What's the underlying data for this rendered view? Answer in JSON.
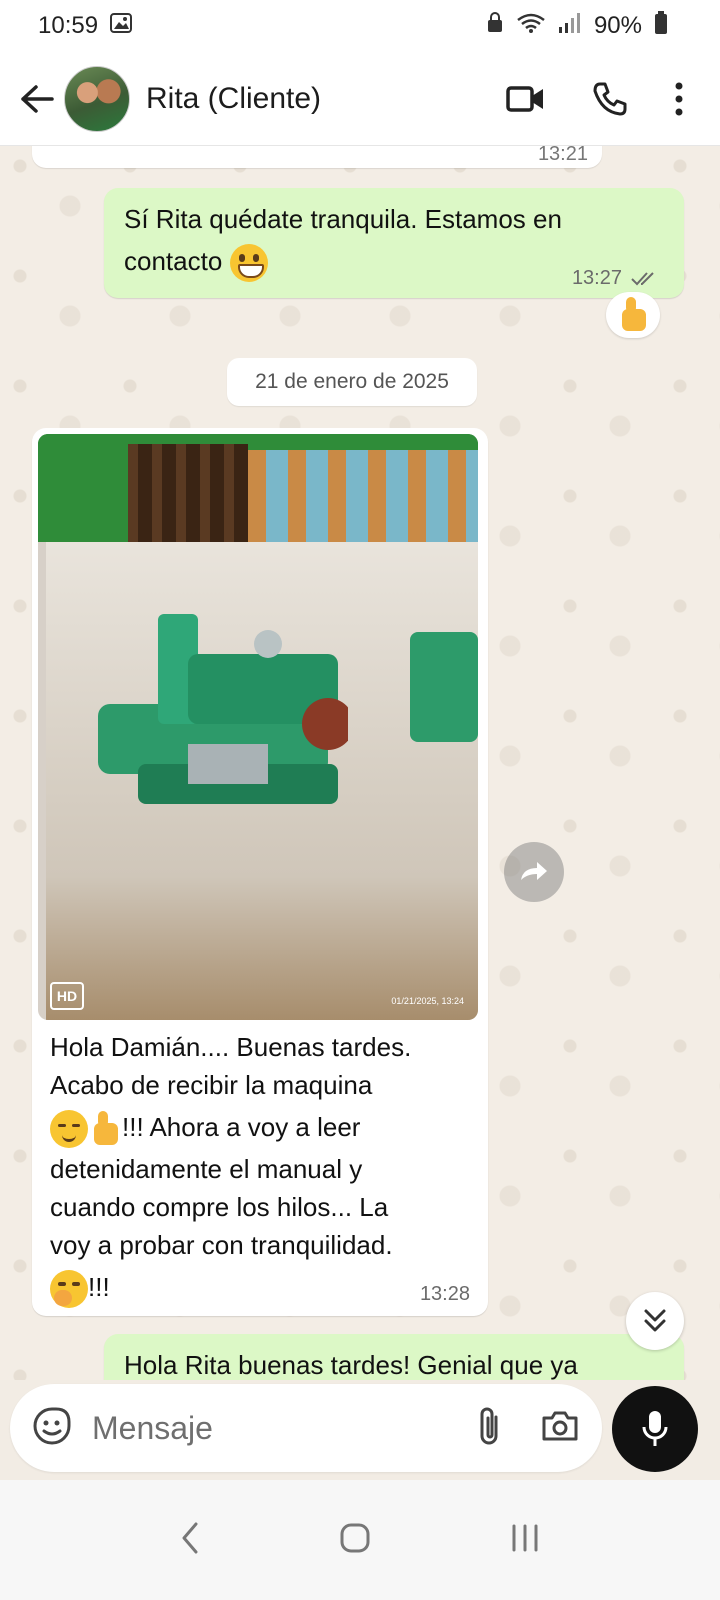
{
  "status_bar": {
    "time": "10:59",
    "battery": "90%"
  },
  "header": {
    "contact_name": "Rita (Cliente)",
    "icons": [
      "back-arrow-icon",
      "video-call-icon",
      "phone-icon",
      "more-vert-icon"
    ]
  },
  "chat": {
    "previous_time": "13:21",
    "messages": [
      {
        "direction": "out",
        "lines": [
          "Sí Rita quédate tranquila. Estamos en",
          "contacto"
        ],
        "emoji": "grinning-face",
        "time": "13:27",
        "status": "read",
        "reaction": "thumbs-up"
      },
      {
        "type": "date",
        "label": "21 de enero de 2025"
      },
      {
        "direction": "in",
        "media": {
          "badge": "HD",
          "stamp": "01/21/2025, 13:24"
        },
        "lines": [
          "Hola Damián.... Buenas tardes.",
          "Acabo de recibir la maquina",
          "!!! Ahora a voy a leer",
          "detenidamente el manual y",
          "cuando compre los hilos... La",
          "voy a probar con tranquilidad.",
          "!!!"
        ],
        "time": "13:28"
      },
      {
        "direction": "out",
        "lines": [
          "Hola Rita buenas tardes! Genial que ya"
        ]
      }
    ]
  },
  "composer": {
    "placeholder": "Mensaje"
  },
  "colors": {
    "outgoing_bubble": "#dcf8c6",
    "incoming_bubble": "#ffffff",
    "chat_background": "#f3ede5",
    "read_ticks": "#6b6b6b"
  }
}
